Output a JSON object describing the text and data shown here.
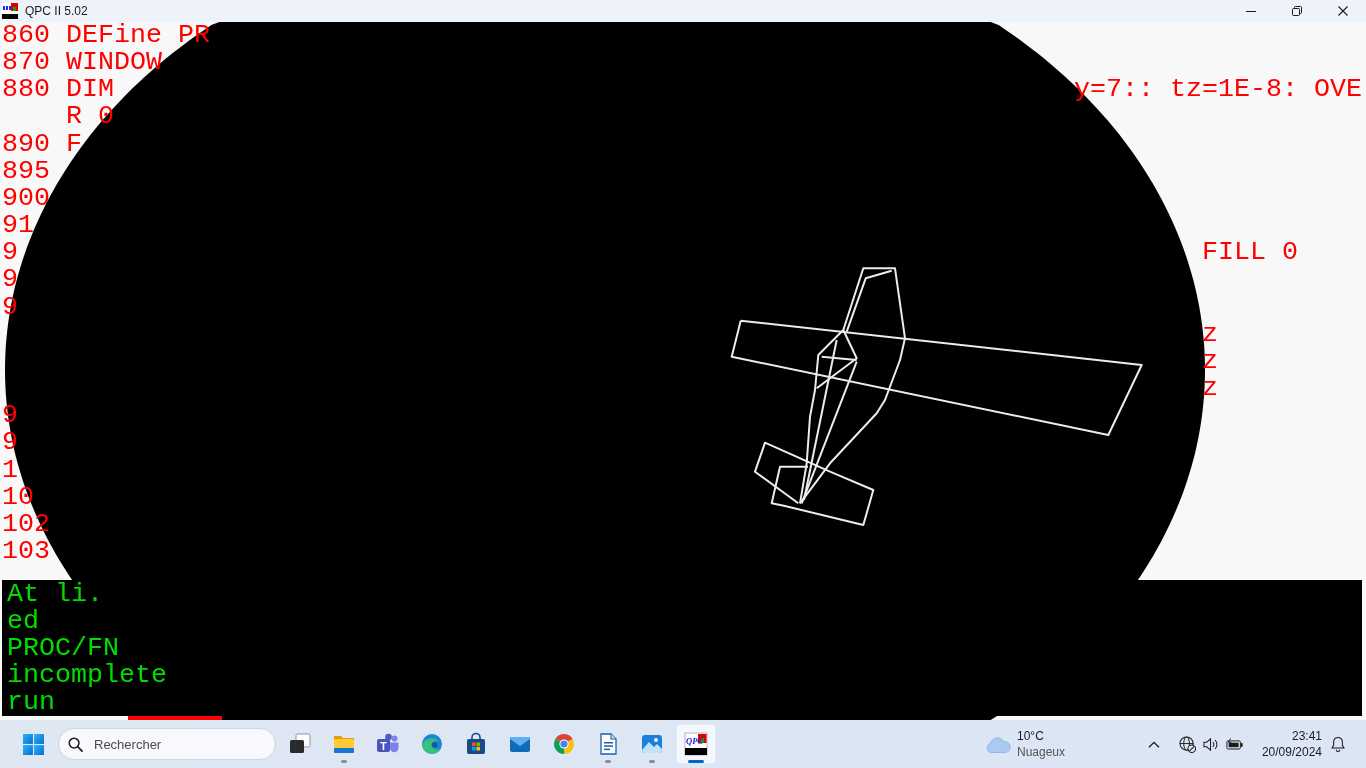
{
  "window": {
    "title": "QPC II 5.02"
  },
  "listing": {
    "lines": [
      {
        "text": "860 DEFine PR",
        "continuation": false
      },
      {
        "text": "870 WINDOW",
        "continuation": false
      },
      {
        "text": "880 DIM",
        "continuation": false,
        "tail": "y=7:: tz=1E-8: OVE"
      },
      {
        "text": "R 0",
        "continuation": true
      },
      {
        "text": "890 F",
        "continuation": false
      },
      {
        "text": "895",
        "continuation": false
      },
      {
        "text": "900",
        "continuation": false
      },
      {
        "text": "91",
        "continuation": false
      },
      {
        "text": "9",
        "continuation": false,
        "tail": "FILL 0"
      },
      {
        "text": "9",
        "continuation": false
      },
      {
        "text": "9",
        "continuation": false
      },
      {
        "tail": "z"
      },
      {
        "tail": "z"
      },
      {
        "tail": "z"
      },
      {
        "text": "9",
        "continuation": false
      },
      {
        "text": "9",
        "continuation": false
      },
      {
        "text": "1",
        "continuation": false
      },
      {
        "text": "10",
        "continuation": false
      },
      {
        "text": "102",
        "continuation": false
      },
      {
        "text": "103",
        "continuation": false
      }
    ]
  },
  "console": {
    "lines": [
      "At li.",
      "ed",
      "PROC/FN",
      "incomplete",
      "run"
    ]
  },
  "taskbar": {
    "search": {
      "placeholder": "Rechercher"
    },
    "apps": [
      {
        "kind": "task-view",
        "running": false,
        "active": false
      },
      {
        "kind": "files",
        "running": true,
        "active": false
      },
      {
        "kind": "chat",
        "logo_text": "T",
        "running": false,
        "active": false
      },
      {
        "kind": "edge",
        "running": false,
        "active": false
      },
      {
        "kind": "store",
        "running": false,
        "active": false
      },
      {
        "kind": "mail",
        "running": false,
        "active": false
      },
      {
        "kind": "chrome",
        "running": false,
        "active": false
      },
      {
        "kind": "writer",
        "running": true,
        "active": false
      },
      {
        "kind": "photos",
        "running": true,
        "active": false
      },
      {
        "kind": "emulator",
        "logo_text": "QPC",
        "running": true,
        "active": true
      }
    ],
    "weather": {
      "temperature": "10°C",
      "condition": "Nuageux"
    },
    "clock": {
      "time": "23:41",
      "date": "20/09/2024"
    }
  }
}
